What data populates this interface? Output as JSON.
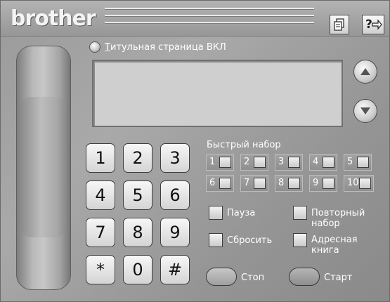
{
  "header": {
    "brand": "brother",
    "icons": [
      "document-icon",
      "help-exit-icon"
    ]
  },
  "title_page": {
    "label_prefix": "Т",
    "label_rest": "итульная страница ВКЛ"
  },
  "keypad": {
    "keys": [
      "1",
      "2",
      "3",
      "4",
      "5",
      "6",
      "7",
      "8",
      "9",
      "*",
      "0",
      "#"
    ]
  },
  "speed_dial": {
    "title": "Быстрый набор",
    "numbers": [
      "1",
      "2",
      "3",
      "4",
      "5",
      "6",
      "7",
      "8",
      "9",
      "10"
    ]
  },
  "controls": {
    "pause": "Пауза",
    "redial_line1": "Повторный",
    "redial_line2": "набор",
    "reset": "Сбросить",
    "address_line1": "Адресная",
    "address_line2": "книга",
    "stop": "Стоп",
    "start": "Старт"
  },
  "colors": {
    "start_button": "#9a9a9a",
    "stop_button": "#b0b0b0"
  }
}
